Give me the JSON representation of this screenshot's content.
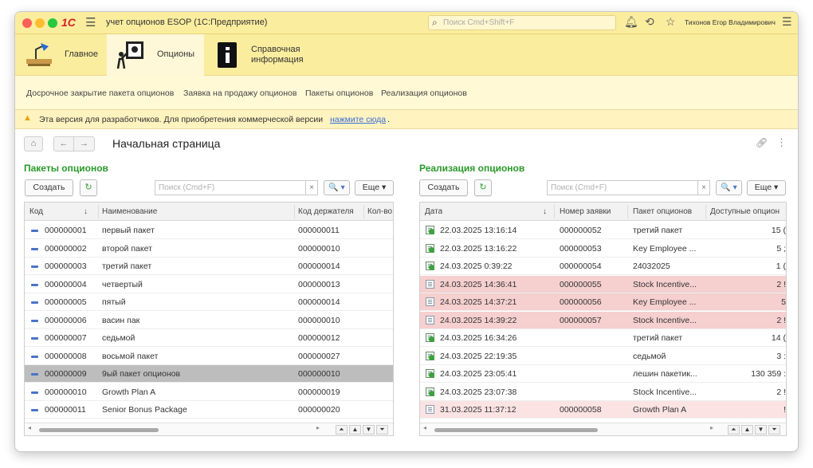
{
  "window": {
    "app_logo": "1С",
    "title": "учет опционов ESOP  (1С:Предприятие)",
    "search_placeholder": "Поиск Cmd+Shift+F",
    "user": "Тихонов Егор Владимирович",
    "traffic": [
      "#fe5f57",
      "#febc2e",
      "#28c840"
    ]
  },
  "sections": [
    {
      "label": "Главное",
      "icon": "desk-lamp-icon"
    },
    {
      "label": "Опционы",
      "icon": "presenter-icon",
      "active": true
    },
    {
      "label_line1": "Справочная",
      "label_line2": "информация",
      "icon": "info-book-icon"
    }
  ],
  "subnav": [
    "Досрочное закрытие пакета опционов",
    "Заявка на продажу опционов",
    "Пакеты опционов",
    "Реализация опционов"
  ],
  "warning": {
    "text": "Эта версия для разработчиков. Для приобретения коммерческой версии",
    "link": "нажмите сюда",
    "tail": "."
  },
  "nav": {
    "home": "⌂",
    "back": "←",
    "forward": "→",
    "title": "Начальная страница"
  },
  "left_panel": {
    "title": "Пакеты опционов",
    "create_label": "Создать",
    "search_placeholder": "Поиск (Cmd+F)",
    "clear": "×",
    "search_btn": "🔍 ▾",
    "more_label": "Еще ▾",
    "columns": [
      "Код",
      "↓",
      "Наименование",
      "Код держателя",
      "Кол-во"
    ],
    "rows": [
      {
        "code": "000000001",
        "name": "первый пакет",
        "holder": "000000011"
      },
      {
        "code": "000000002",
        "name": "второй пакет",
        "holder": "000000010"
      },
      {
        "code": "000000003",
        "name": "третий пакет",
        "holder": "000000014"
      },
      {
        "code": "000000004",
        "name": "четвертый",
        "holder": "000000013"
      },
      {
        "code": "000000005",
        "name": "пятый",
        "holder": "000000014"
      },
      {
        "code": "000000006",
        "name": "васин пак",
        "holder": "000000010"
      },
      {
        "code": "000000007",
        "name": "седьмой",
        "holder": "000000012"
      },
      {
        "code": "000000008",
        "name": "восьмой пакет",
        "holder": "000000027"
      },
      {
        "code": "000000009",
        "name": "9ый пакет опционов",
        "holder": "000000010",
        "selected": true
      },
      {
        "code": "000000010",
        "name": "Growth Plan A",
        "holder": "000000019"
      },
      {
        "code": "000000011",
        "name": "Senior Bonus Package",
        "holder": "000000020"
      }
    ],
    "selected_color": "#bdbdbd"
  },
  "right_panel": {
    "title": "Реализация опционов",
    "create_label": "Создать",
    "search_placeholder": "Поиск (Cmd+F)",
    "clear": "×",
    "search_btn": "🔍 ▾",
    "more_label": "Еще ▾",
    "columns": [
      "Дата",
      "↓",
      "Номер заявки",
      "Пакет опционов",
      "Доступные опцион"
    ],
    "rows": [
      {
        "date": "22.03.2025 13:16:14",
        "num": "000000052",
        "pkg": "третий пакет",
        "avail": "15 (",
        "posted": true
      },
      {
        "date": "22.03.2025 13:16:22",
        "num": "000000053",
        "pkg": "Key Employee ...",
        "avail": "5 ;",
        "posted": true
      },
      {
        "date": "24.03.2025 0:39:22",
        "num": "000000054",
        "pkg": "24032025",
        "avail": "1 (",
        "posted": true
      },
      {
        "date": "24.03.2025 14:36:41",
        "num": "000000055",
        "pkg": "Stock Incentive...",
        "avail": "2 !",
        "posted": false,
        "highlight": "#f6cfcf"
      },
      {
        "date": "24.03.2025 14:37:21",
        "num": "000000056",
        "pkg": "Key Employee ...",
        "avail": "5",
        "posted": false,
        "highlight": "#f6cfcf"
      },
      {
        "date": "24.03.2025 14:39:22",
        "num": "000000057",
        "pkg": "Stock Incentive...",
        "avail": "2 !",
        "posted": false,
        "highlight": "#f6cfcf"
      },
      {
        "date": "24.03.2025 16:34:26",
        "num": "",
        "pkg": "третий пакет",
        "avail": "14 (",
        "posted": true
      },
      {
        "date": "24.03.2025 22:19:35",
        "num": "",
        "pkg": "седьмой",
        "avail": "3 :",
        "posted": true
      },
      {
        "date": "24.03.2025 23:05:41",
        "num": "",
        "pkg": "лешин пакетик...",
        "avail": "130 359 :",
        "posted": true
      },
      {
        "date": "24.03.2025 23:07:38",
        "num": "",
        "pkg": "Stock Incentive...",
        "avail": "2 !",
        "posted": true
      },
      {
        "date": "31.03.2025 11:37:12",
        "num": "000000058",
        "pkg": "Growth Plan A",
        "avail": "!",
        "posted": false,
        "highlight": "#fbe3e3"
      }
    ]
  },
  "scroll": {
    "left": "◂",
    "right": "▸",
    "first": "⏶",
    "up": "▲",
    "down": "▼",
    "last": "⏷"
  }
}
